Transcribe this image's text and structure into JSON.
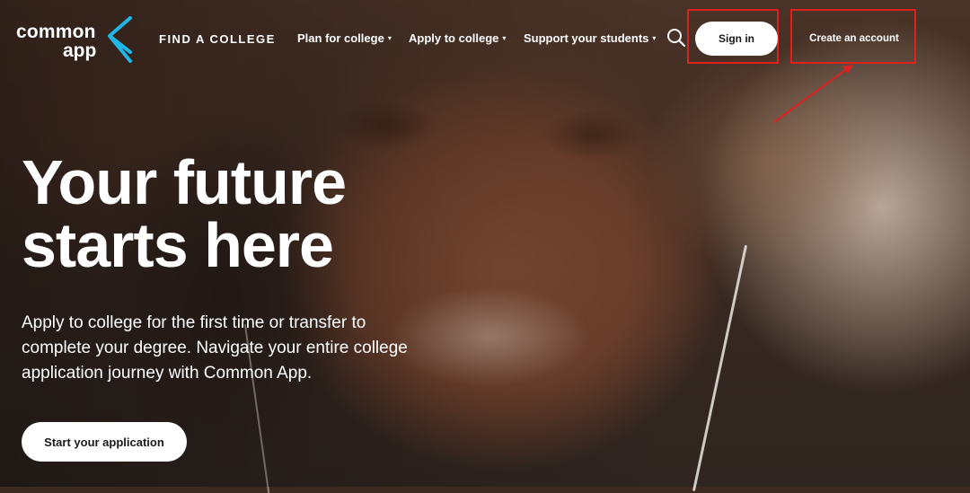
{
  "brand": {
    "logo_line1": "common",
    "logo_line2": "app",
    "mark_color": "#1fb6e8"
  },
  "nav": {
    "find_college": "FIND A COLLEGE",
    "items": [
      {
        "label": "Plan for college",
        "caret": "▾"
      },
      {
        "label": "Apply to college",
        "caret": "▾"
      },
      {
        "label": "Support your students",
        "caret": "▾"
      }
    ],
    "search_icon": "search-icon",
    "sign_in": "Sign in",
    "create_account": "Create an account"
  },
  "annotation": {
    "highlight_color": "#e0201c"
  },
  "hero": {
    "headline_line1": "Your future",
    "headline_line2": "starts here",
    "subcopy": "Apply to college for the first time or transfer to complete your degree. Navigate your entire college application journey with Common App.",
    "cta_label": "Start your application"
  }
}
